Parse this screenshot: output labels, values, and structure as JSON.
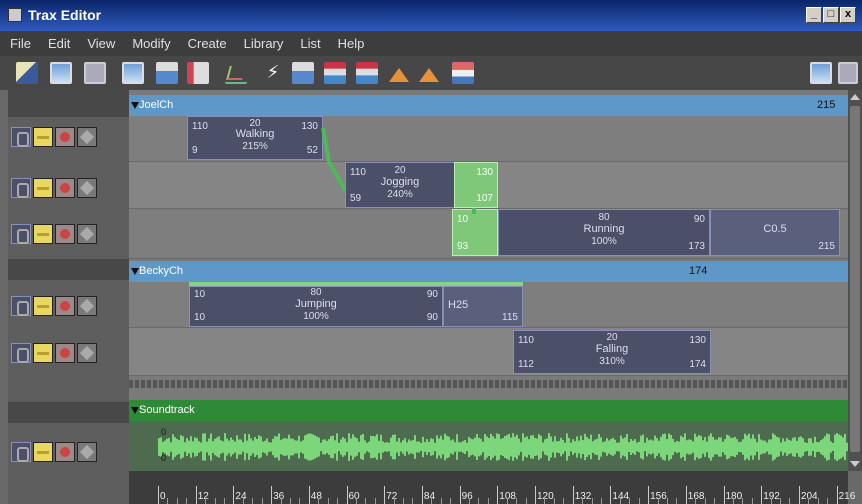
{
  "window": {
    "title": "Trax Editor",
    "controls": [
      "_",
      "□",
      "x"
    ]
  },
  "menu": [
    "File",
    "Edit",
    "View",
    "Modify",
    "Create",
    "Library",
    "List",
    "Help"
  ],
  "toolbar": {
    "icons": [
      "load-clip-icon",
      "insert-icon",
      "graph-icon",
      "frame-all-icon",
      "merge-icon",
      "split-icon",
      "curve-icon",
      "run-icon",
      "keys-icon",
      "sheet-icon",
      "sheet2-icon",
      "cone-icon",
      "cone2-icon",
      "flag-icon"
    ],
    "right_icons": [
      "layout-icon",
      "panel-icon"
    ]
  },
  "characters": [
    {
      "name": "JoelCh",
      "end": "215",
      "tracks": [
        {
          "clips": [
            {
              "name": "Walking",
              "weight": "20",
              "scale": "215%",
              "start_in": "110",
              "end_in": "130",
              "start": "9",
              "end": "52"
            }
          ]
        },
        {
          "clips": [
            {
              "name": "Jogging",
              "weight": "20",
              "scale": "240%",
              "start_in": "110",
              "start": "59"
            },
            {
              "name": "",
              "end_in": "130",
              "end": "107",
              "green": true
            }
          ]
        },
        {
          "clips": [
            {
              "name": "",
              "start_in": "10",
              "start": "93",
              "green": true
            },
            {
              "name": "Running",
              "weight": "80",
              "scale": "100%",
              "end_in": "90",
              "end": "173"
            },
            {
              "name": "C0.5",
              "end": "215"
            }
          ]
        }
      ]
    },
    {
      "name": "BeckyCh",
      "end": "174",
      "tracks": [
        {
          "clips": [
            {
              "name": "Jumping",
              "weight": "80",
              "scale": "100%",
              "start_in": "10",
              "end_in": "90",
              "start": "10",
              "end": "90"
            },
            {
              "name": "H25",
              "end": "115"
            }
          ]
        },
        {
          "clips": [
            {
              "name": "Falling",
              "weight": "20",
              "scale": "310%",
              "start_in": "110",
              "end_in": "130",
              "start": "112",
              "end": "174"
            }
          ]
        }
      ]
    }
  ],
  "soundtrack": {
    "label": "Soundtrack",
    "top_mark": "0",
    "bottom_mark": "0"
  },
  "ruler": {
    "labels": [
      "0",
      "12",
      "24",
      "36",
      "48",
      "60",
      "72",
      "84",
      "96",
      "108",
      "120",
      "132",
      "144",
      "156",
      "168",
      "180",
      "192",
      "204",
      "216"
    ]
  }
}
